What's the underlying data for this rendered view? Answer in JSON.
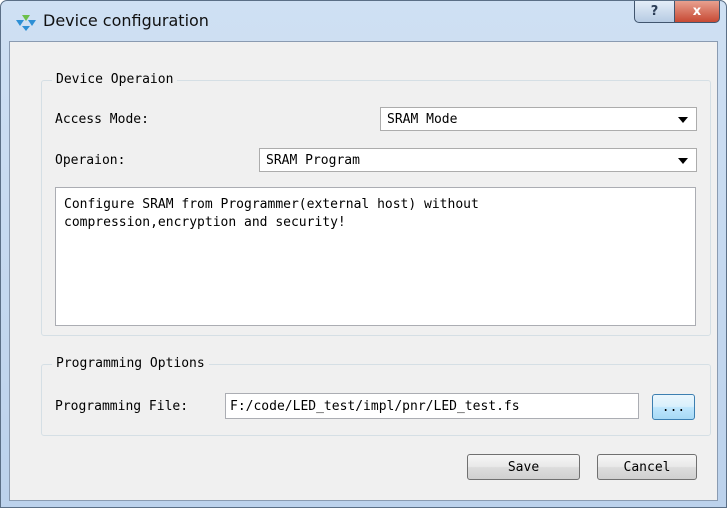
{
  "window": {
    "title": "Device configuration",
    "help_glyph": "?",
    "close_glyph": "x",
    "icon": "gowin-logo-icon"
  },
  "device_operation": {
    "group_title": "Device Operaion",
    "access_mode_label": "Access Mode:",
    "access_mode_value": "SRAM Mode",
    "operation_label": "Operaion:",
    "operation_value": "SRAM Program",
    "description": "Configure SRAM from Programmer(external host) without\ncompression,encryption and security!"
  },
  "programming_options": {
    "group_title": "Programming Options",
    "file_label": "Programming File:",
    "file_value": "F:/code/LED_test/impl/pnr/LED_test.fs",
    "browse_label": "..."
  },
  "buttons": {
    "save_label": "Save",
    "cancel_label": "Cancel"
  },
  "colors": {
    "title_bar": "#c4d8ee",
    "close_button": "#c74a34",
    "browse_button": "#bee6fd"
  }
}
